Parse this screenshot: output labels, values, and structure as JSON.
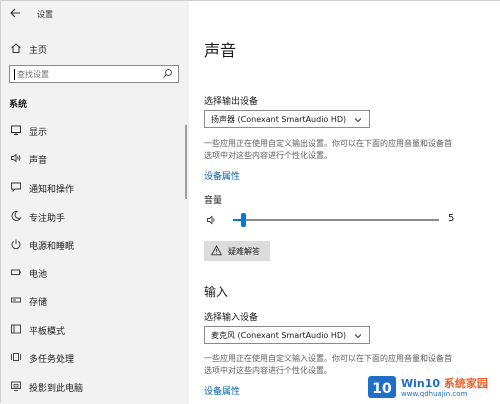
{
  "window": {
    "title": "设置"
  },
  "sidebar": {
    "home_label": "主页",
    "search_placeholder": "查找设置",
    "section_heading": "系统",
    "items": [
      {
        "icon": "monitor-icon",
        "label": "显示"
      },
      {
        "icon": "speaker-icon",
        "label": "声音"
      },
      {
        "icon": "notification-icon",
        "label": "通知和操作"
      },
      {
        "icon": "moon-icon",
        "label": "专注助手"
      },
      {
        "icon": "power-icon",
        "label": "电源和睡眠"
      },
      {
        "icon": "battery-icon",
        "label": "电池"
      },
      {
        "icon": "storage-icon",
        "label": "存储"
      },
      {
        "icon": "tablet-icon",
        "label": "平板模式"
      },
      {
        "icon": "multitask-icon",
        "label": "多任务处理"
      },
      {
        "icon": "project-icon",
        "label": "投影到此电脑"
      }
    ]
  },
  "main": {
    "title": "声音",
    "output": {
      "label": "选择输出设备",
      "selected": "扬声器 (Conexant SmartAudio HD)",
      "help": "一些应用正在使用自定义输出设置。你可以在下面的应用音量和设备首选项中对这些内容进行个性化设置。",
      "link": "设备属性"
    },
    "volume": {
      "label": "音量",
      "value": "5",
      "level_percent": 5
    },
    "troubleshoot_label": "疑难解答",
    "input": {
      "section_title": "输入",
      "label": "选择输入设备",
      "selected": "麦克风 (Conexant SmartAudio HD)",
      "help": "一些应用正在使用自定义输入设置。你可以在下面的应用音量和设备首选项中对这些内容进行个性化设置。",
      "link": "设备属性"
    }
  },
  "watermark": {
    "brand_main": "Win10",
    "brand_accent": "系统家园",
    "url": "www.qdhuajin.com"
  },
  "colors": {
    "accent": "#0078d7",
    "link": "#0063b1",
    "sidebar_bg": "#f2f2f2"
  }
}
